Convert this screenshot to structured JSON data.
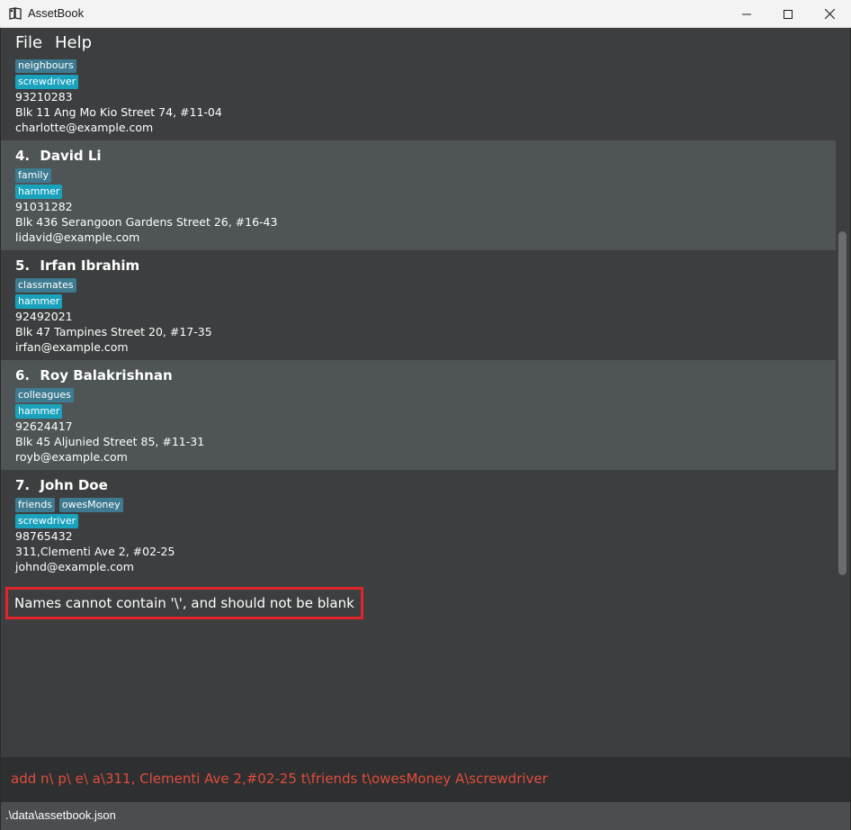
{
  "window": {
    "title": "AssetBook",
    "icon": "book-icon"
  },
  "menu": {
    "items": [
      {
        "label": "File"
      },
      {
        "label": "Help"
      }
    ]
  },
  "persons": [
    {
      "index": "",
      "name": "",
      "groups": [
        "neighbours"
      ],
      "assets": [
        "screwdriver"
      ],
      "phone": "93210283",
      "address": "Blk 11 Ang Mo Kio Street 74, #11-04",
      "email": "charlotte@example.com"
    },
    {
      "index": "4.",
      "name": "David Li",
      "groups": [
        "family"
      ],
      "assets": [
        "hammer"
      ],
      "phone": "91031282",
      "address": "Blk 436 Serangoon Gardens Street 26, #16-43",
      "email": "lidavid@example.com"
    },
    {
      "index": "5.",
      "name": "Irfan Ibrahim",
      "groups": [
        "classmates"
      ],
      "assets": [
        "hammer"
      ],
      "phone": "92492021",
      "address": "Blk 47 Tampines Street 20, #17-35",
      "email": "irfan@example.com"
    },
    {
      "index": "6.",
      "name": "Roy Balakrishnan",
      "groups": [
        "colleagues"
      ],
      "assets": [
        "hammer"
      ],
      "phone": "92624417",
      "address": "Blk 45 Aljunied Street 85, #11-31",
      "email": "royb@example.com"
    },
    {
      "index": "7.",
      "name": "John Doe",
      "groups": [
        "friends",
        "owesMoney"
      ],
      "assets": [
        "screwdriver"
      ],
      "phone": "98765432",
      "address": "311,Clementi Ave 2, #02-25",
      "email": "johnd@example.com"
    }
  ],
  "result": {
    "message": "Names cannot contain '\\', and should not be blank"
  },
  "command": {
    "value": "add n\\ p\\ e\\ a\\311, Clementi Ave 2,#02-25 t\\friends t\\owesMoney A\\screwdriver"
  },
  "status": {
    "path": ".\\data\\assetbook.json"
  },
  "colors": {
    "group_tag": "#3e7b91",
    "asset_tag": "#1aa2bd",
    "error_text": "#e24c3d",
    "error_border": "#e0242b"
  }
}
